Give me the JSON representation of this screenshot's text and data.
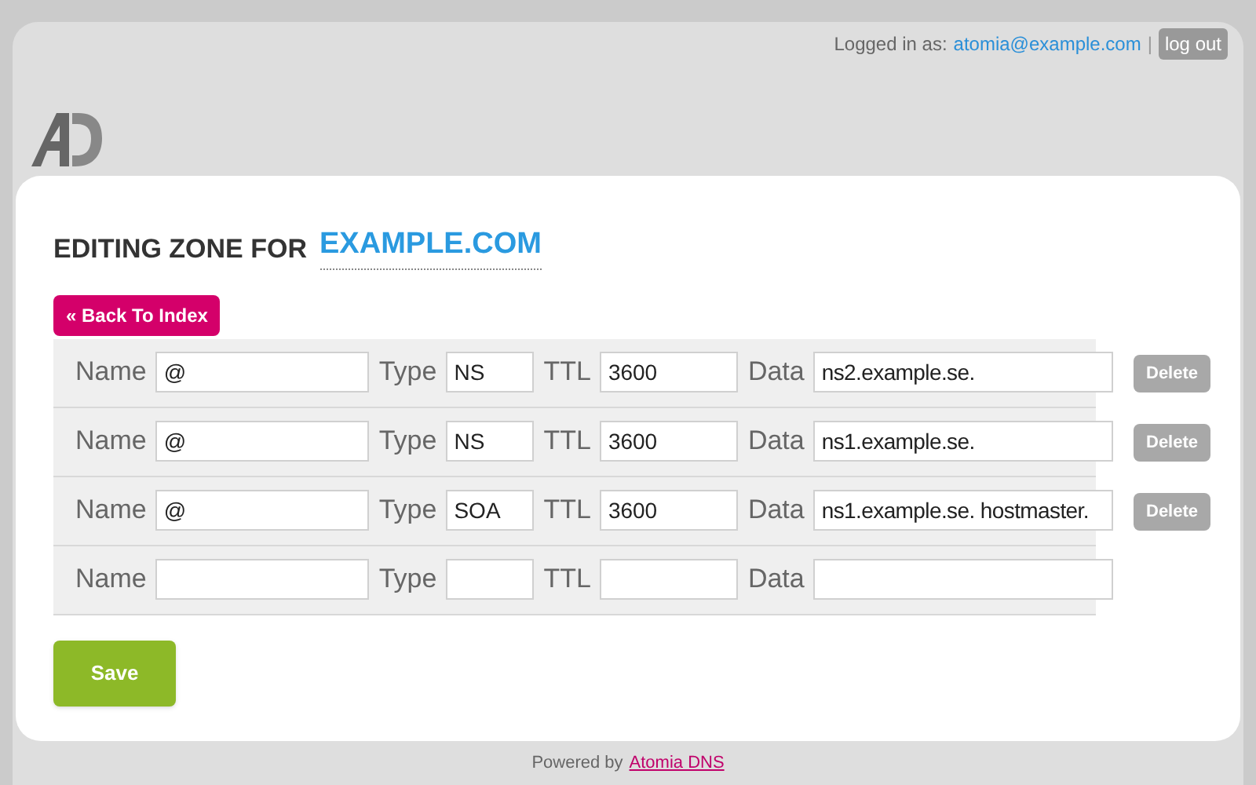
{
  "header": {
    "logged_in_label": "Logged in as:",
    "user": "atomia@example.com",
    "separator": "|",
    "logout": "log out"
  },
  "title": {
    "prefix": "EDITING ZONE FOR",
    "zone": "EXAMPLE.COM"
  },
  "back_button": "« Back To Index",
  "records": [
    {
      "name_label": "Name",
      "name": "@",
      "type_label": "Type",
      "type": "NS",
      "ttl_label": "TTL",
      "ttl": "3600",
      "data_label": "Data",
      "data": "ns2.example.se.",
      "delete": "Delete"
    },
    {
      "name_label": "Name",
      "name": "@",
      "type_label": "Type",
      "type": "NS",
      "ttl_label": "TTL",
      "ttl": "3600",
      "data_label": "Data",
      "data": "ns1.example.se.",
      "delete": "Delete"
    },
    {
      "name_label": "Name",
      "name": "@",
      "type_label": "Type",
      "type": "SOA",
      "ttl_label": "TTL",
      "ttl": "3600",
      "data_label": "Data",
      "data": "ns1.example.se. hostmaster.",
      "delete": "Delete"
    },
    {
      "name_label": "Name",
      "type_label": "Type",
      "ttl_label": "TTL",
      "data_label": "Data"
    }
  ],
  "save_button": "Save",
  "footer": {
    "prefix": "Powered by",
    "link": "Atomia DNS"
  }
}
